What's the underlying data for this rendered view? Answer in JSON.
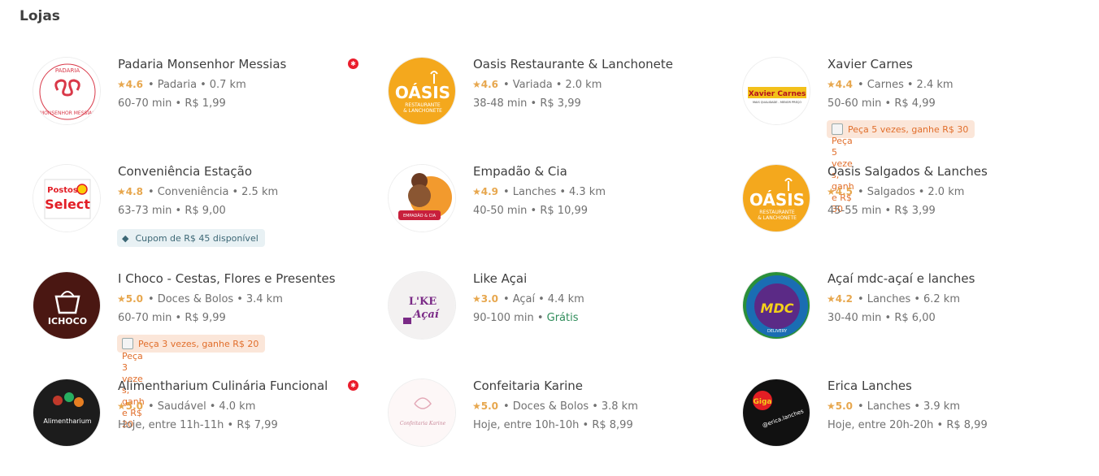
{
  "section": {
    "title": "Lojas"
  },
  "stores": [
    {
      "name": "Padaria Monsenhor Messias",
      "rating": "4.6",
      "category": "Padaria",
      "distance": "0.7 km",
      "time": "60-70 min",
      "fee": "R$ 1,99",
      "logo": "padaria-logo",
      "super_badge": true
    },
    {
      "name": "Oasis Restaurante & Lanchonete",
      "rating": "4.6",
      "category": "Variada",
      "distance": "2.0 km",
      "time": "38-48 min",
      "fee": "R$ 3,99",
      "logo": "oasis-logo"
    },
    {
      "name": "Xavier Carnes",
      "rating": "4.4",
      "category": "Carnes",
      "distance": "2.4 km",
      "time": "50-60 min",
      "fee": "R$ 4,99",
      "logo": "xavier-logo",
      "reward": "Peça 5 vezes, ganhe R$ 30",
      "reward_alt": "Peça 5 vezes, ganhe R$ 30"
    },
    {
      "name": "Conveniência Estação",
      "rating": "4.8",
      "category": "Conveniência",
      "distance": "2.5 km",
      "time": "63-73 min",
      "fee": "R$ 9,00",
      "logo": "postos-select-logo",
      "coupon": "Cupom de R$ 45 disponível"
    },
    {
      "name": "Empadão & Cia",
      "rating": "4.9",
      "category": "Lanches",
      "distance": "4.3 km",
      "time": "40-50 min",
      "fee": "R$ 10,99",
      "logo": "empadao-logo"
    },
    {
      "name": "Oasis Salgados & Lanches",
      "rating": "4.5",
      "category": "Salgados",
      "distance": "2.0 km",
      "time": "45-55 min",
      "fee": "R$ 3,99",
      "logo": "oasis-logo"
    },
    {
      "name": "I Choco - Cestas, Flores e Presentes",
      "rating": "5.0",
      "category": "Doces & Bolos",
      "distance": "3.4 km",
      "time": "60-70 min",
      "fee": "R$ 9,99",
      "logo": "ichoco-logo",
      "reward": "Peça 3 vezes, ganhe R$ 20",
      "reward_alt": "Peça 3 vezes, ganhe R$ 20"
    },
    {
      "name": "Like Açai",
      "rating": "3.0",
      "category": "Açaí",
      "distance": "4.4 km",
      "time": "90-100 min",
      "fee": "Grátis",
      "fee_free": true,
      "logo": "like-acai-logo"
    },
    {
      "name": "Açaí mdc-açaí e lanches",
      "rating": "4.2",
      "category": "Lanches",
      "distance": "6.2 km",
      "time": "30-40 min",
      "fee": "R$ 6,00",
      "logo": "mdc-logo"
    },
    {
      "name": "Alimentharium Culinária Funcional",
      "rating": "5.0",
      "category": "Saudável",
      "distance": "4.0 km",
      "time": "Hoje, entre 11h-11h",
      "fee": "R$ 7,99",
      "logo": "alimentharium-logo",
      "super_badge": true
    },
    {
      "name": "Confeitaria Karine",
      "rating": "5.0",
      "category": "Doces & Bolos",
      "distance": "3.8 km",
      "time": "Hoje, entre 10h-10h",
      "fee": "R$ 8,99",
      "logo": "confeitaria-logo"
    },
    {
      "name": "Erica Lanches",
      "rating": "5.0",
      "category": "Lanches",
      "distance": "3.9 km",
      "time": "Hoje, entre 20h-20h",
      "fee": "R$ 8,99",
      "logo": "erica-logo"
    }
  ],
  "logo_text": {
    "padaria": [
      "PADARIA",
      "MONSENHOR MESSIAS"
    ],
    "oasis": [
      "OÁSIS",
      "RESTAURANTE",
      "& LANCHONETE"
    ],
    "xavier": [
      "Xavier Carnes",
      "MAIS QUALIDADE - MENOR PREÇO"
    ],
    "postos": [
      "Postos",
      "Select"
    ],
    "empadao": [
      "EMPADÃO & CIA"
    ],
    "ichoco": [
      "ICHOCO"
    ],
    "like": [
      "L'KE",
      "Açaí"
    ],
    "mdc": [
      "MDC",
      "DELIVERY"
    ],
    "alimentharium": [
      "Alimentharium"
    ],
    "confeitaria": [
      "Confeitaria Karine"
    ],
    "erica": [
      "Giga",
      "@erica.lanches"
    ]
  },
  "colors": {
    "accent": "#ea1d2c",
    "rating": "#e7a74e",
    "reward": "#e16e2b",
    "free": "#2f8c5a",
    "coupon": "#3c6775"
  }
}
